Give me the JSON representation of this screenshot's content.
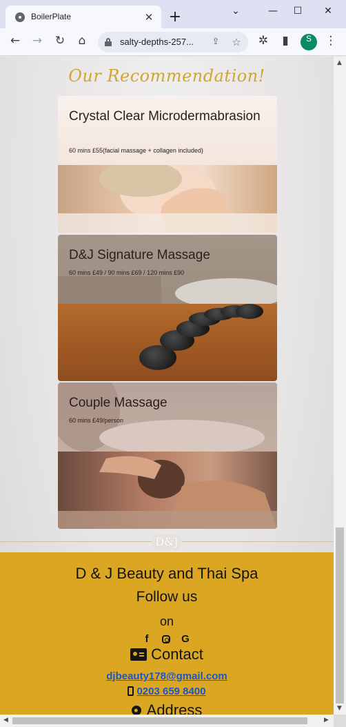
{
  "browser": {
    "tab_title": "BoilerPlate",
    "url": "salty-depths-257...",
    "profile_initial": "S",
    "icons": {
      "back": "arrow-left-icon",
      "forward": "arrow-right-icon",
      "reload": "reload-icon",
      "home": "home-icon",
      "extensions": "puzzle-icon",
      "sidepanel": "side-panel-icon",
      "menu": "kebab-menu-icon"
    }
  },
  "page": {
    "heading": "Our Recommendation!",
    "services": [
      {
        "title": "Crystal Clear Microdermabrasion",
        "price": "60 mins £55(facial massage + collagen included)"
      },
      {
        "title": "D&J Signature Massage",
        "price": "60 mins £49 / 90 mins £69 / 120 mins £90"
      },
      {
        "title": "Couple Massage",
        "price": "60 mins £49/person"
      }
    ],
    "monogram": "D&J"
  },
  "footer": {
    "brand": "D & J Beauty and Thai Spa",
    "follow": "Follow us",
    "on": "on",
    "social": {
      "facebook": "f",
      "google": "G"
    },
    "contact_heading": "Contact",
    "email": "djbeauty178@gmail.com",
    "phone": "0203 659 8400",
    "address_heading": "Address",
    "accent_color": "#dba722",
    "link_color": "#1a56c8"
  }
}
